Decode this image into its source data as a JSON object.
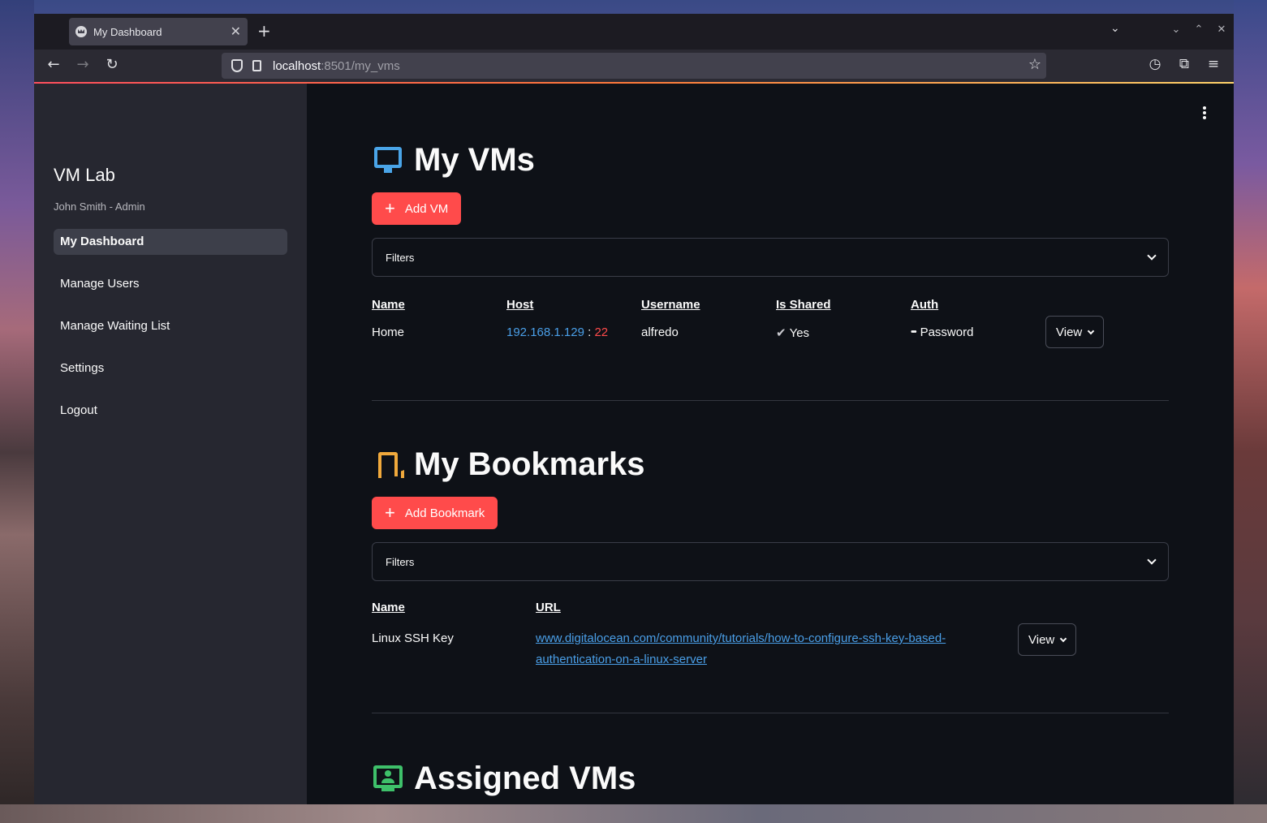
{
  "browser": {
    "tab_title": "My Dashboard",
    "url_host": "localhost",
    "url_path": ":8501/my_vms"
  },
  "sidebar": {
    "brand": "VM Lab",
    "subtitle": "John Smith - Admin",
    "items": [
      {
        "label": "My Dashboard",
        "active": true
      },
      {
        "label": "Manage Users"
      },
      {
        "label": "Manage Waiting List"
      },
      {
        "label": "Settings"
      },
      {
        "label": "Logout"
      }
    ]
  },
  "vms": {
    "title": "My VMs",
    "add_label": "Add VM",
    "filters_label": "Filters",
    "columns": [
      "Name",
      "Host",
      "Username",
      "Is Shared",
      "Auth"
    ],
    "rows": [
      {
        "name": "Home",
        "host_ip": "192.168.1.129",
        "host_sep": ":",
        "host_port": "22",
        "username": "alfredo",
        "is_shared": "Yes",
        "auth": "Password",
        "view_label": "View"
      }
    ]
  },
  "bookmarks": {
    "title": "My Bookmarks",
    "add_label": "Add Bookmark",
    "filters_label": "Filters",
    "columns": [
      "Name",
      "URL"
    ],
    "rows": [
      {
        "name": "Linux SSH Key",
        "url_line1": "www.digitalocean.com/community/tutorials/how-to-configure-ssh-key-based-",
        "url_line2": "authentication-on-a-linux-server",
        "view_label": "View"
      }
    ]
  },
  "assigned": {
    "title": "Assigned VMs"
  },
  "colors": {
    "accent": "#ff4b4b",
    "link": "#4a9fe8",
    "vm_icon": "#4aa5e8",
    "bookmark_icon": "#f0a93c",
    "assigned_icon": "#3ec06a"
  },
  "icons": [
    "monitor-icon",
    "bookmark-icon",
    "assigned-user-icon",
    "check-icon",
    "password-dots-icon",
    "chevron-down-icon",
    "plus-icon",
    "kebab-menu-icon"
  ]
}
